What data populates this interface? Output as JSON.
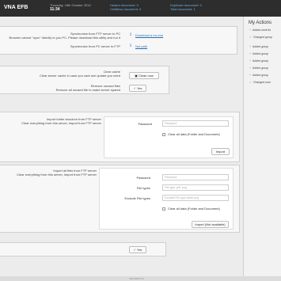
{
  "header": {
    "brand": "VNA EFB",
    "date_line": "Thursday, 16th October 2014",
    "time": "11:34",
    "stats": [
      "Healed document: 0",
      "Childless document: 0",
      "Duplicate document: 0",
      "Total document: 1"
    ]
  },
  "sync": {
    "line1": "Synchronize from FTP server to PC",
    "line2": "Browser cannot \"sync\" directly to you PC, Please download this utility and run it",
    "download_link": "Download a mc.exe",
    "line3": "Synchronize from PC server to FTP",
    "run_link": "Not path"
  },
  "cache": {
    "clear_title": "Clear cache",
    "clear_desc": "Clear server cache in case you cant see update you need",
    "clear_button": "Clean now",
    "remove_title": "Remove unused files",
    "remove_desc": "Remove all unused file to make server spared",
    "remove_button": "Yes"
  },
  "import_structure": {
    "title": "Import folder structure from FTP server",
    "desc": "Clear everything from this server, import from FTP server",
    "password_label": "Password",
    "password_placeholder": "Password",
    "clear_label": "Clear all data (Folder and Document)",
    "button": "Import"
  },
  "import_files": {
    "title": "Import all files from FTP server",
    "desc": "Clear everything from this server, import from FTP server",
    "password_label": "Password",
    "password_placeholder": "Password",
    "filetypes_label": "File types",
    "filetypes_placeholder": "File type .pdf .png",
    "exclude_label": "Exclude File types",
    "exclude_placeholder": "Exclude File type folder.png",
    "clear_label": "Clear all data (Folder and Document)",
    "button": "Import (Not available)"
  },
  "last": {
    "button": "Yes"
  },
  "sidebar": {
    "title": "My Actions",
    "actions": [
      "Added work flo",
      "Changed group",
      "Added group",
      "Added group",
      "Added group",
      "Added group",
      "Added group",
      "Changed user"
    ]
  },
  "footer": {
    "version": "VNA EFB v1.0"
  }
}
